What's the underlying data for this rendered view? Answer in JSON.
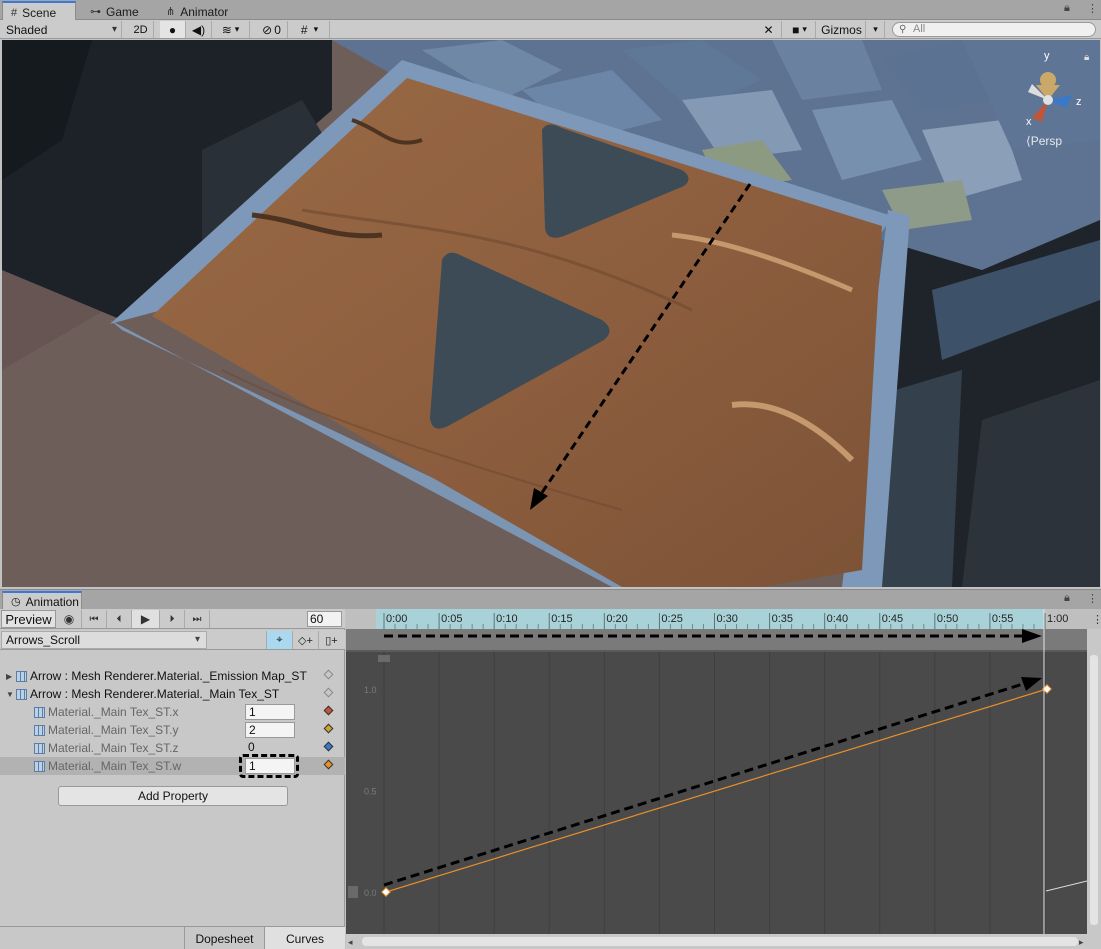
{
  "scene_window": {
    "tabs": [
      {
        "label": "Scene",
        "icon": "grid-icon"
      },
      {
        "label": "Game",
        "icon": "gamepad-icon"
      },
      {
        "label": "Animator",
        "icon": "animator-icon"
      }
    ],
    "toolbar": {
      "shading_mode": "Shaded",
      "mode_2d_label": "2D",
      "hidden_count": "0",
      "gizmos_label": "Gizmos",
      "search_placeholder": "All"
    },
    "gizmo": {
      "y_label": "y",
      "x_label": "x",
      "z_label": "z",
      "projection_label": "Persp"
    }
  },
  "animation_window": {
    "tab_label": "Animation",
    "preview_label": "Preview",
    "frame_rate": "60",
    "clip_name": "Arrows_Scroll",
    "properties": [
      {
        "label": "Arrow : Mesh Renderer.Material._Emission Map_ST",
        "expanded": false
      },
      {
        "label": "Arrow : Mesh Renderer.Material._Main Tex_ST",
        "expanded": true
      }
    ],
    "sub_properties": [
      {
        "label": "Material._Main Tex_ST.x",
        "value": "1",
        "key_color": "#c0553a"
      },
      {
        "label": "Material._Main Tex_ST.y",
        "value": "2",
        "key_color": "#c9a23a"
      },
      {
        "label": "Material._Main Tex_ST.z",
        "value": "0",
        "key_color": "#3a78c9"
      },
      {
        "label": "Material._Main Tex_ST.w",
        "value": "1",
        "key_color": "#e8902a"
      }
    ],
    "add_property_label": "Add Property",
    "view_tabs": {
      "dopesheet": "Dopesheet",
      "curves": "Curves"
    },
    "timeline": {
      "ticks": [
        "0:00",
        "0:05",
        "0:10",
        "0:15",
        "0:20",
        "0:25",
        "0:30",
        "0:35",
        "0:40",
        "0:45",
        "0:50",
        "0:55",
        "1:00"
      ]
    },
    "curve_axis": {
      "labels": [
        "1.0",
        "0.5",
        "0.0"
      ]
    },
    "curve": {
      "start_value": 0,
      "end_value": 1,
      "start_time": "0:00",
      "end_time": "1:00",
      "color": "#e8902a"
    }
  }
}
